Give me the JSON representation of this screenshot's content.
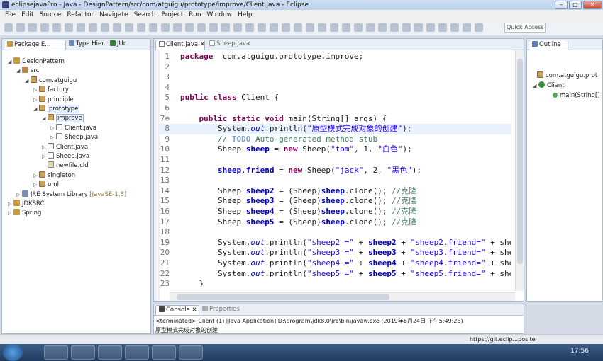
{
  "window": {
    "title": "eclipsejavaPro - Java - DesignPattern/src/com/atguigu/prototype/improve/Client.java - Eclipse"
  },
  "menu": [
    "File",
    "Edit",
    "Source",
    "Refactor",
    "Navigate",
    "Search",
    "Project",
    "Run",
    "Window",
    "Help"
  ],
  "toolbar": {
    "quick_access": "Quick Access"
  },
  "explorer": {
    "tabs": [
      "Package E...",
      "Type Hier...",
      "JUr"
    ],
    "tree": [
      {
        "label": "DesignPattern",
        "depth": 0,
        "arrow": "◢",
        "icon": "proj"
      },
      {
        "label": "src",
        "depth": 1,
        "arrow": "◢",
        "icon": "src"
      },
      {
        "label": "com.atguigu",
        "depth": 2,
        "arrow": "◢",
        "icon": "pkg"
      },
      {
        "label": "factory",
        "depth": 3,
        "arrow": "▷",
        "icon": "pkg"
      },
      {
        "label": "principle",
        "depth": 3,
        "arrow": "▷",
        "icon": "pkg"
      },
      {
        "label": "prototype",
        "depth": 3,
        "arrow": "◢",
        "icon": "pkg",
        "selected": true
      },
      {
        "label": "improve",
        "depth": 4,
        "arrow": "◢",
        "icon": "pkg",
        "selected": true
      },
      {
        "label": "Client.java",
        "depth": 5,
        "arrow": "▷",
        "icon": "java"
      },
      {
        "label": "Sheep.java",
        "depth": 5,
        "arrow": "▷",
        "icon": "java"
      },
      {
        "label": "Client.java",
        "depth": 4,
        "arrow": "▷",
        "icon": "java"
      },
      {
        "label": "Sheep.java",
        "depth": 4,
        "arrow": "▷",
        "icon": "java"
      },
      {
        "label": "newfile.cld",
        "depth": 4,
        "arrow": "",
        "icon": "file"
      },
      {
        "label": "singleton",
        "depth": 3,
        "arrow": "▷",
        "icon": "pkg"
      },
      {
        "label": "uml",
        "depth": 3,
        "arrow": "▷",
        "icon": "pkg"
      },
      {
        "label": "JRE System Library",
        "note": "[JavaSE-1.8]",
        "depth": 1,
        "arrow": "▷",
        "icon": "jre"
      },
      {
        "label": "JDKSRC",
        "depth": 0,
        "arrow": "▷",
        "icon": "proj"
      },
      {
        "label": "Spring",
        "depth": 0,
        "arrow": "▷",
        "icon": "proj"
      }
    ]
  },
  "editor": {
    "tabs": [
      "Client.java",
      "Sheep.java"
    ],
    "lines": [
      {
        "n": "1",
        "code": [
          [
            "kw",
            "package"
          ],
          [
            "",
            "  com.atguigu.prototype.improve;"
          ]
        ]
      },
      {
        "n": "2",
        "code": []
      },
      {
        "n": "3",
        "code": []
      },
      {
        "n": "4",
        "code": []
      },
      {
        "n": "5",
        "code": [
          [
            "kw",
            "public class"
          ],
          [
            "",
            " Client {"
          ]
        ]
      },
      {
        "n": "6",
        "code": []
      },
      {
        "n": "7⊖",
        "code": [
          [
            "",
            "    "
          ],
          [
            "kw",
            "public static void"
          ],
          [
            "",
            " main(String[] args) {"
          ]
        ]
      },
      {
        "n": "8",
        "hl": true,
        "code": [
          [
            "",
            "        System."
          ],
          [
            "ital",
            "out"
          ],
          [
            "",
            ".println("
          ],
          [
            "str",
            "\"原型模式完成对象的创建\""
          ],
          [
            "",
            ");"
          ]
        ]
      },
      {
        "n": "9",
        "code": [
          [
            "cmt",
            "        // "
          ],
          [
            "todo",
            "TODO"
          ],
          [
            "cmt",
            " Auto-generated method stub"
          ]
        ]
      },
      {
        "n": "10",
        "code": [
          [
            "",
            "        Sheep "
          ],
          [
            "fld",
            "sheep"
          ],
          [
            "",
            " = "
          ],
          [
            "kw",
            "new"
          ],
          [
            "",
            " Sheep("
          ],
          [
            "str",
            "\"tom\""
          ],
          [
            "",
            ", 1, "
          ],
          [
            "str",
            "\"白色\""
          ],
          [
            "",
            ");"
          ]
        ]
      },
      {
        "n": "11",
        "code": []
      },
      {
        "n": "12",
        "code": [
          [
            "",
            "        "
          ],
          [
            "fld",
            "sheep"
          ],
          [
            "",
            "."
          ],
          [
            "fld",
            "friend"
          ],
          [
            "",
            " = "
          ],
          [
            "kw",
            "new"
          ],
          [
            "",
            " Sheep("
          ],
          [
            "str",
            "\"jack\""
          ],
          [
            "",
            ", 2, "
          ],
          [
            "str",
            "\"黑色\""
          ],
          [
            "",
            ");"
          ]
        ]
      },
      {
        "n": "13",
        "code": []
      },
      {
        "n": "14",
        "code": [
          [
            "",
            "        Sheep "
          ],
          [
            "fld",
            "sheep2"
          ],
          [
            "",
            " = (Sheep)"
          ],
          [
            "fld",
            "sheep"
          ],
          [
            "",
            ".clone(); "
          ],
          [
            "cmt",
            "//克隆"
          ]
        ]
      },
      {
        "n": "15",
        "code": [
          [
            "",
            "        Sheep "
          ],
          [
            "fld",
            "sheep3"
          ],
          [
            "",
            " = (Sheep)"
          ],
          [
            "fld",
            "sheep"
          ],
          [
            "",
            ".clone(); "
          ],
          [
            "cmt",
            "//克隆"
          ]
        ]
      },
      {
        "n": "16",
        "code": [
          [
            "",
            "        Sheep "
          ],
          [
            "fld",
            "sheep4"
          ],
          [
            "",
            " = (Sheep)"
          ],
          [
            "fld",
            "sheep"
          ],
          [
            "",
            ".clone(); "
          ],
          [
            "cmt",
            "//克隆"
          ]
        ]
      },
      {
        "n": "17",
        "code": [
          [
            "",
            "        Sheep "
          ],
          [
            "fld",
            "sheep5"
          ],
          [
            "",
            " = (Sheep)"
          ],
          [
            "fld",
            "sheep"
          ],
          [
            "",
            ".clone(); "
          ],
          [
            "cmt",
            "//克隆"
          ]
        ]
      },
      {
        "n": "18",
        "code": []
      },
      {
        "n": "19",
        "code": [
          [
            "",
            "        System."
          ],
          [
            "ital",
            "out"
          ],
          [
            "",
            ".println("
          ],
          [
            "str",
            "\"sheep2 =\""
          ],
          [
            "",
            " + "
          ],
          [
            "fld",
            "sheep2"
          ],
          [
            "",
            " + "
          ],
          [
            "str",
            "\"sheep2.friend=\""
          ],
          [
            "",
            " + she"
          ]
        ]
      },
      {
        "n": "20",
        "code": [
          [
            "",
            "        System."
          ],
          [
            "ital",
            "out"
          ],
          [
            "",
            ".println("
          ],
          [
            "str",
            "\"sheep3 =\""
          ],
          [
            "",
            " + "
          ],
          [
            "fld",
            "sheep3"
          ],
          [
            "",
            " + "
          ],
          [
            "str",
            "\"sheep3.friend=\""
          ],
          [
            "",
            " + she"
          ]
        ]
      },
      {
        "n": "21",
        "code": [
          [
            "",
            "        System."
          ],
          [
            "ital",
            "out"
          ],
          [
            "",
            ".println("
          ],
          [
            "str",
            "\"sheep4 =\""
          ],
          [
            "",
            " + "
          ],
          [
            "fld",
            "sheep4"
          ],
          [
            "",
            " + "
          ],
          [
            "str",
            "\"sheep4.friend=\""
          ],
          [
            "",
            " + she"
          ]
        ]
      },
      {
        "n": "22",
        "code": [
          [
            "",
            "        System."
          ],
          [
            "ital",
            "out"
          ],
          [
            "",
            ".println("
          ],
          [
            "str",
            "\"sheep5 =\""
          ],
          [
            "",
            " + "
          ],
          [
            "fld",
            "sheep5"
          ],
          [
            "",
            " + "
          ],
          [
            "str",
            "\"sheep5.friend=\""
          ],
          [
            "",
            " + she"
          ]
        ]
      },
      {
        "n": "23",
        "code": [
          [
            "",
            "    }"
          ]
        ]
      }
    ]
  },
  "outline": {
    "tab": "Outline",
    "items": [
      {
        "label": "com.atguigu.prot"
      },
      {
        "label": "Client"
      },
      {
        "label": "main(String[]"
      }
    ]
  },
  "console": {
    "tabs": [
      "Console",
      "Properties"
    ],
    "status": "<terminated> Client (1) [Java Application] D:\\program\\jdk8.0\\jre\\bin\\javaw.exe (2019年6月24日 下午5:49:23)",
    "output": "原型模式完成对象的创建"
  },
  "statusbar": {
    "url": "https://git.eclip...posite"
  },
  "taskbar": {
    "time": "17:56"
  },
  "colors": {
    "keyword": "#7f0055",
    "string": "#2a00ff",
    "field": "#0000c0",
    "comment": "#3f7f5f"
  }
}
